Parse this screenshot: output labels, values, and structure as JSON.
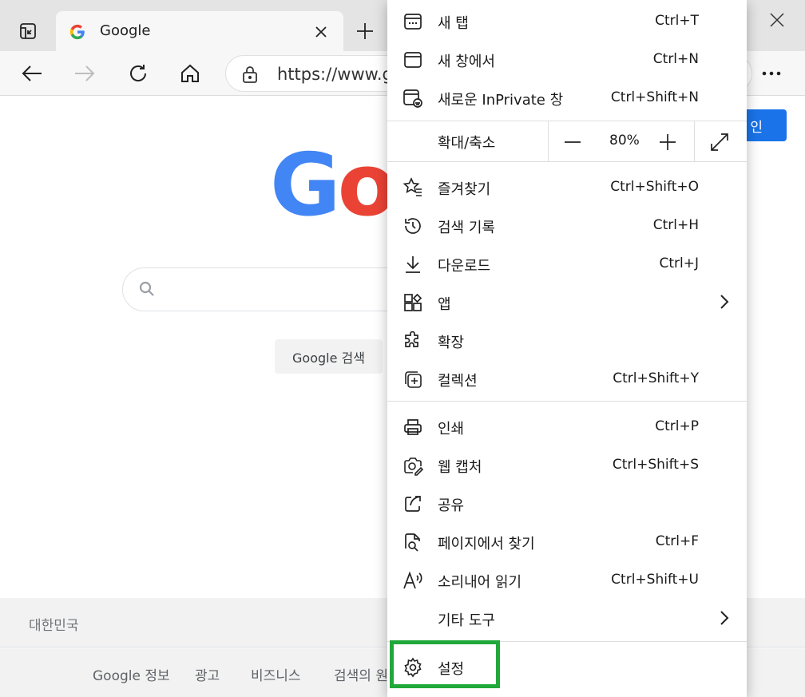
{
  "tab": {
    "title": "Google",
    "favicon": "google-g-icon"
  },
  "address_bar": {
    "url": "https://www.g"
  },
  "page": {
    "signin_label": "인",
    "logo_text_1": "G",
    "logo_text_2": "o",
    "search_button": "Google 검색",
    "country": "대한민국",
    "footer_links": [
      "Google 정보",
      "광고",
      "비즈니스",
      "검색의 원"
    ]
  },
  "menu": {
    "items_top": [
      {
        "label": "새 탭",
        "shortcut": "Ctrl+T",
        "icon": "new-tab-icon"
      },
      {
        "label": "새 창에서",
        "shortcut": "Ctrl+N",
        "icon": "new-window-icon"
      },
      {
        "label": "새로운 InPrivate 창",
        "shortcut": "Ctrl+Shift+N",
        "icon": "inprivate-window-icon"
      }
    ],
    "zoom": {
      "label": "확대/축소",
      "value": "80%"
    },
    "items_mid": [
      {
        "label": "즐겨찾기",
        "shortcut": "Ctrl+Shift+O",
        "icon": "favorites-icon"
      },
      {
        "label": "검색 기록",
        "shortcut": "Ctrl+H",
        "icon": "history-icon"
      },
      {
        "label": "다운로드",
        "shortcut": "Ctrl+J",
        "icon": "download-icon"
      },
      {
        "label": "앱",
        "shortcut": "",
        "icon": "apps-icon",
        "submenu": true
      },
      {
        "label": "확장",
        "shortcut": "",
        "icon": "extensions-icon"
      },
      {
        "label": "컬렉션",
        "shortcut": "Ctrl+Shift+Y",
        "icon": "collections-icon"
      }
    ],
    "items_low": [
      {
        "label": "인쇄",
        "shortcut": "Ctrl+P",
        "icon": "print-icon"
      },
      {
        "label": "웹 캡처",
        "shortcut": "Ctrl+Shift+S",
        "icon": "web-capture-icon"
      },
      {
        "label": "공유",
        "shortcut": "",
        "icon": "share-icon"
      },
      {
        "label": "페이지에서 찾기",
        "shortcut": "Ctrl+F",
        "icon": "find-in-page-icon"
      },
      {
        "label": "소리내어 읽기",
        "shortcut": "Ctrl+Shift+U",
        "icon": "read-aloud-icon"
      },
      {
        "label": "기타 도구",
        "shortcut": "",
        "icon": "",
        "submenu": true
      }
    ],
    "settings": {
      "label": "설정",
      "icon": "gear-icon"
    }
  },
  "colors": {
    "highlight": "#21a83a",
    "accent": "#1a73e8"
  }
}
